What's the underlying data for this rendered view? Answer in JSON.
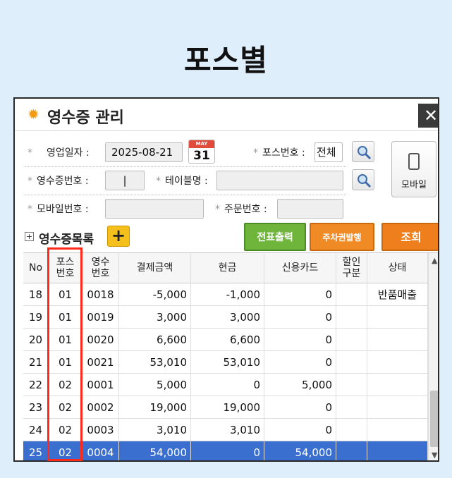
{
  "page_title": "포스별",
  "window": {
    "title": "영수증 관리",
    "close": "✕"
  },
  "search": {
    "sales_date_label": "영업일자 :",
    "sales_date_value": "2025-08-21",
    "calendar_month": "MAY",
    "calendar_day": "31",
    "pos_no_label": "포스번호 :",
    "pos_no_value": "전체",
    "receipt_no_label": "영수증번호 :",
    "receipt_no_value": "|",
    "table_name_label": "테이블명 :",
    "table_name_value": "",
    "mobile_no_label": "모바일번호 :",
    "mobile_no_value": "",
    "order_no_label": "주문번호 :",
    "order_no_value": "",
    "star": "*"
  },
  "mobile_button": "모바일",
  "list": {
    "expand": "+",
    "title": "영수증목록",
    "add": "+",
    "print_button": "전표출력",
    "parking_button": "주차권발행",
    "query_button": "조회"
  },
  "grid": {
    "headers": {
      "no": "No",
      "pos_top": "포스",
      "pos_bottom": "번호",
      "rcpt_top": "영수",
      "rcpt_bottom": "번호",
      "amount": "결제금액",
      "cash": "현금",
      "card": "신용카드",
      "disc_top": "할인",
      "disc_bottom": "구분",
      "status": "상태"
    },
    "rows": [
      {
        "no": "18",
        "pos": "01",
        "rcpt": "0018",
        "amount": "-5,000",
        "cash": "-1,000",
        "card": "0",
        "disc": "",
        "status": "반품매출"
      },
      {
        "no": "19",
        "pos": "01",
        "rcpt": "0019",
        "amount": "3,000",
        "cash": "3,000",
        "card": "0",
        "disc": "",
        "status": ""
      },
      {
        "no": "20",
        "pos": "01",
        "rcpt": "0020",
        "amount": "6,600",
        "cash": "6,600",
        "card": "0",
        "disc": "",
        "status": ""
      },
      {
        "no": "21",
        "pos": "01",
        "rcpt": "0021",
        "amount": "53,010",
        "cash": "53,010",
        "card": "0",
        "disc": "",
        "status": ""
      },
      {
        "no": "22",
        "pos": "02",
        "rcpt": "0001",
        "amount": "5,000",
        "cash": "0",
        "card": "5,000",
        "disc": "",
        "status": ""
      },
      {
        "no": "23",
        "pos": "02",
        "rcpt": "0002",
        "amount": "19,000",
        "cash": "19,000",
        "card": "0",
        "disc": "",
        "status": ""
      },
      {
        "no": "24",
        "pos": "02",
        "rcpt": "0003",
        "amount": "3,010",
        "cash": "3,010",
        "card": "0",
        "disc": "",
        "status": ""
      },
      {
        "no": "25",
        "pos": "02",
        "rcpt": "0004",
        "amount": "54,000",
        "cash": "0",
        "card": "54,000",
        "disc": "",
        "status": ""
      }
    ],
    "selected_row_index": 7,
    "scroll_up": "▲",
    "scroll_down": "▼"
  },
  "colors": {
    "highlight_border": "#ff2a1a",
    "selected_row": "#3a6fcf",
    "green_button": "#6fb43b",
    "orange_button": "#f08a24"
  }
}
